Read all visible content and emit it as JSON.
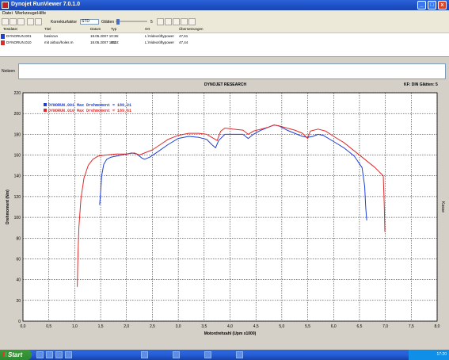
{
  "window": {
    "title": "Dynojet RunViewer 7.0.1.0",
    "minimize_glyph": "_",
    "maximize_glyph": "□",
    "close_glyph": "x"
  },
  "menu": [
    "Datei",
    "Werkzeuge",
    "Hilfe"
  ],
  "toolbar": {
    "factor_label": "Korrekturfaktor",
    "factor_value": "STD",
    "smoothing_label": "Glätten",
    "smoothing_value": "5"
  },
  "runlist": {
    "headers": [
      "Testdatei",
      "Titel",
      "Datum",
      "Typ",
      "Ort",
      "Übersetzungen"
    ],
    "rows": [
      {
        "file": "DYNORUN.001",
        "title": "basisrun",
        "date": "18.05.2007 10:36:",
        "type": "",
        "location": "L:\\Videos\\ftypower",
        "ratio": "47,61",
        "color": "#1f3fd6"
      },
      {
        "file": "DYNORUN.010",
        "title": "mit airbox/holes m",
        "date": "18.05.2007 12:43:",
        "type": "RD",
        "location": "L:\\Videos\\ftypower",
        "ratio": "47,44",
        "color": "#e02b2b"
      }
    ]
  },
  "notes": {
    "label": "Notizen",
    "value": ""
  },
  "graph_header": {
    "title": "DYNOJET RESEARCH",
    "right": "KF: DIN  Glätten: 5"
  },
  "colors": {
    "run1": "#1f3fd6",
    "run2": "#e02b2b",
    "plot_bg": "#ffffff",
    "grid": "#000000"
  },
  "chart_data": {
    "type": "line",
    "title": "",
    "xlabel": "Motordrehzahl (Upm x1000)",
    "ylabel": "Drehmoment (Nm)",
    "right_label": "Kasse",
    "xlim": [
      0,
      8
    ],
    "ylim": [
      0,
      220
    ],
    "xticks": [
      "0,0",
      "0,5",
      "1,0",
      "1,5",
      "2,0",
      "2,5",
      "3,0",
      "3,5",
      "4,0",
      "4,5",
      "5,0",
      "5,5",
      "6,0",
      "6,5",
      "7,0",
      "7,5",
      "8,0"
    ],
    "yticks": [
      "0",
      "20",
      "40",
      "60",
      "80",
      "100",
      "120",
      "140",
      "160",
      "180",
      "200",
      "220"
    ],
    "grid": true,
    "legend_position": "top-left",
    "series": [
      {
        "name": "DYNORUN.001 Max Drehmoment = 189,21",
        "color": "#1f3fd6",
        "points": [
          [
            1.48,
            112
          ],
          [
            1.5,
            125
          ],
          [
            1.52,
            140
          ],
          [
            1.56,
            151
          ],
          [
            1.62,
            156
          ],
          [
            1.7,
            158
          ],
          [
            1.8,
            159
          ],
          [
            1.9,
            160
          ],
          [
            2.0,
            161
          ],
          [
            2.1,
            162
          ],
          [
            2.2,
            161
          ],
          [
            2.3,
            157
          ],
          [
            2.35,
            156
          ],
          [
            2.45,
            158
          ],
          [
            2.6,
            163
          ],
          [
            2.8,
            170
          ],
          [
            3.0,
            176
          ],
          [
            3.2,
            178
          ],
          [
            3.4,
            177
          ],
          [
            3.55,
            175
          ],
          [
            3.65,
            170
          ],
          [
            3.72,
            167
          ],
          [
            3.78,
            174
          ],
          [
            3.9,
            180
          ],
          [
            4.1,
            180
          ],
          [
            4.25,
            180
          ],
          [
            4.35,
            176
          ],
          [
            4.45,
            180
          ],
          [
            4.6,
            184
          ],
          [
            4.75,
            187
          ],
          [
            4.85,
            189
          ],
          [
            4.95,
            188
          ],
          [
            5.1,
            184
          ],
          [
            5.25,
            181
          ],
          [
            5.4,
            178
          ],
          [
            5.5,
            177
          ],
          [
            5.6,
            178
          ],
          [
            5.7,
            180
          ],
          [
            5.8,
            179
          ],
          [
            6.0,
            173
          ],
          [
            6.2,
            167
          ],
          [
            6.4,
            159
          ],
          [
            6.55,
            148
          ],
          [
            6.6,
            130
          ],
          [
            6.62,
            110
          ],
          [
            6.64,
            97
          ]
        ]
      },
      {
        "name": "DYNORUN.010 Max Drehmoment = 189,61",
        "color": "#e02b2b",
        "points": [
          [
            1.05,
            33
          ],
          [
            1.06,
            60
          ],
          [
            1.08,
            90
          ],
          [
            1.12,
            118
          ],
          [
            1.18,
            138
          ],
          [
            1.26,
            150
          ],
          [
            1.35,
            156
          ],
          [
            1.45,
            159
          ],
          [
            1.6,
            160
          ],
          [
            1.8,
            161
          ],
          [
            2.0,
            161
          ],
          [
            2.15,
            162
          ],
          [
            2.25,
            160
          ],
          [
            2.35,
            162
          ],
          [
            2.5,
            165
          ],
          [
            2.65,
            170
          ],
          [
            2.8,
            175
          ],
          [
            3.0,
            179
          ],
          [
            3.2,
            181
          ],
          [
            3.4,
            181
          ],
          [
            3.55,
            180
          ],
          [
            3.65,
            177
          ],
          [
            3.75,
            174
          ],
          [
            3.82,
            183
          ],
          [
            3.9,
            186
          ],
          [
            4.05,
            185
          ],
          [
            4.25,
            184
          ],
          [
            4.35,
            180
          ],
          [
            4.45,
            183
          ],
          [
            4.6,
            185
          ],
          [
            4.75,
            187
          ],
          [
            4.85,
            189
          ],
          [
            4.95,
            188
          ],
          [
            5.1,
            186
          ],
          [
            5.25,
            184
          ],
          [
            5.4,
            181
          ],
          [
            5.5,
            176
          ],
          [
            5.55,
            183
          ],
          [
            5.7,
            185
          ],
          [
            5.85,
            183
          ],
          [
            6.0,
            178
          ],
          [
            6.2,
            172
          ],
          [
            6.4,
            164
          ],
          [
            6.6,
            156
          ],
          [
            6.8,
            148
          ],
          [
            6.92,
            142
          ],
          [
            6.96,
            140
          ],
          [
            6.98,
            110
          ],
          [
            6.99,
            86
          ]
        ]
      }
    ]
  },
  "taskbar": {
    "start_label": "Start",
    "clock": "17:20"
  }
}
